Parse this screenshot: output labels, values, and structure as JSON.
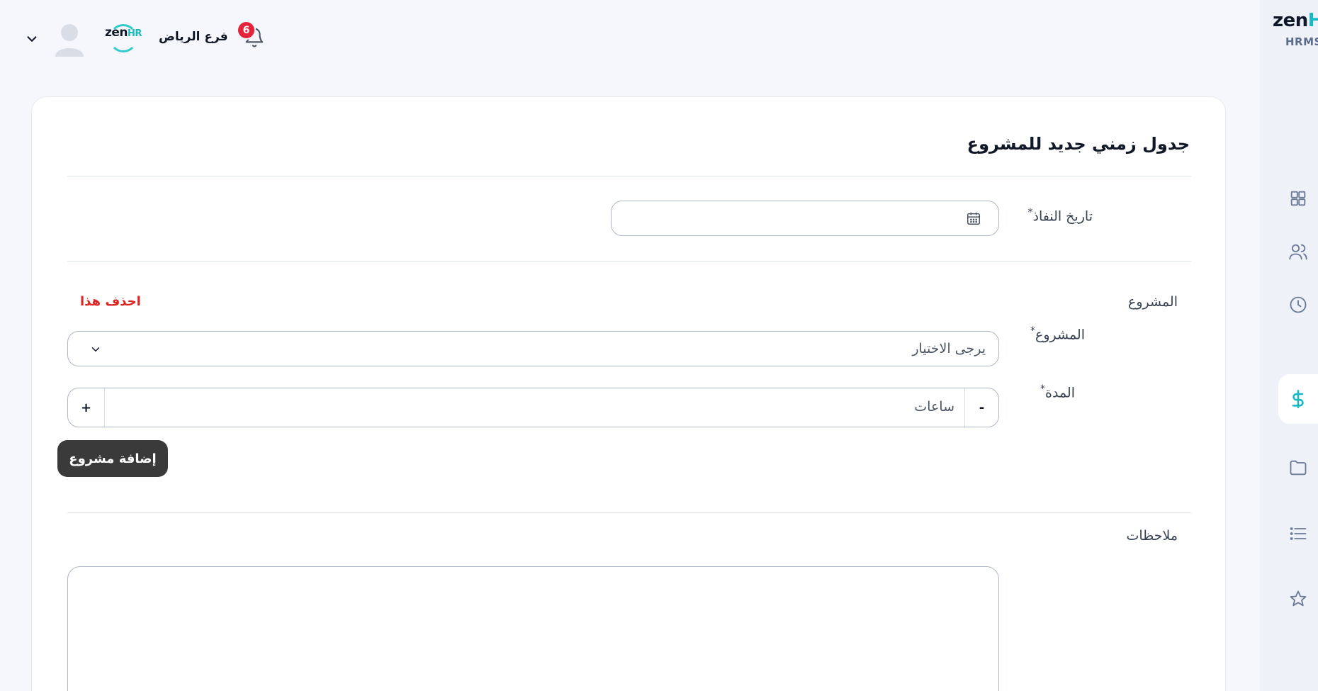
{
  "header": {
    "branch_name": "فرع الرياض",
    "logo_text": "zen",
    "logo_suffix": "HR",
    "notification_count": "6"
  },
  "sidebar": {
    "brand": "zen",
    "brand_suffix": "H",
    "product": "HRMS",
    "items": [
      {
        "icon": "grid-icon",
        "active": false
      },
      {
        "icon": "users-icon",
        "active": false
      },
      {
        "icon": "clock-icon",
        "active": false
      },
      {
        "icon": "dollar-icon",
        "active": true
      },
      {
        "icon": "folder-icon",
        "active": false
      },
      {
        "icon": "list-icon",
        "active": false
      },
      {
        "icon": "star-icon",
        "active": false
      }
    ]
  },
  "form": {
    "title": "جدول زمني جديد للمشروع",
    "effective_date_label": "تاريخ النفاذ",
    "required_mark": "*",
    "effective_date_value": "",
    "project_section_label": "المشروع",
    "delete_label": "احذف هذا",
    "project_label": "المشروع",
    "project_placeholder": "يرجى الاختيار",
    "duration_label": "المدة",
    "duration_placeholder": "ساعات",
    "plus": "+",
    "minus": "-",
    "add_project_label": "إضافة مشروع",
    "notes_label": "ملاحظات",
    "notes_value": ""
  },
  "colors": {
    "accent": "#16b9c4",
    "danger": "#dc2626",
    "badge": "#e5243b",
    "button_dark": "#3a3a3a"
  }
}
